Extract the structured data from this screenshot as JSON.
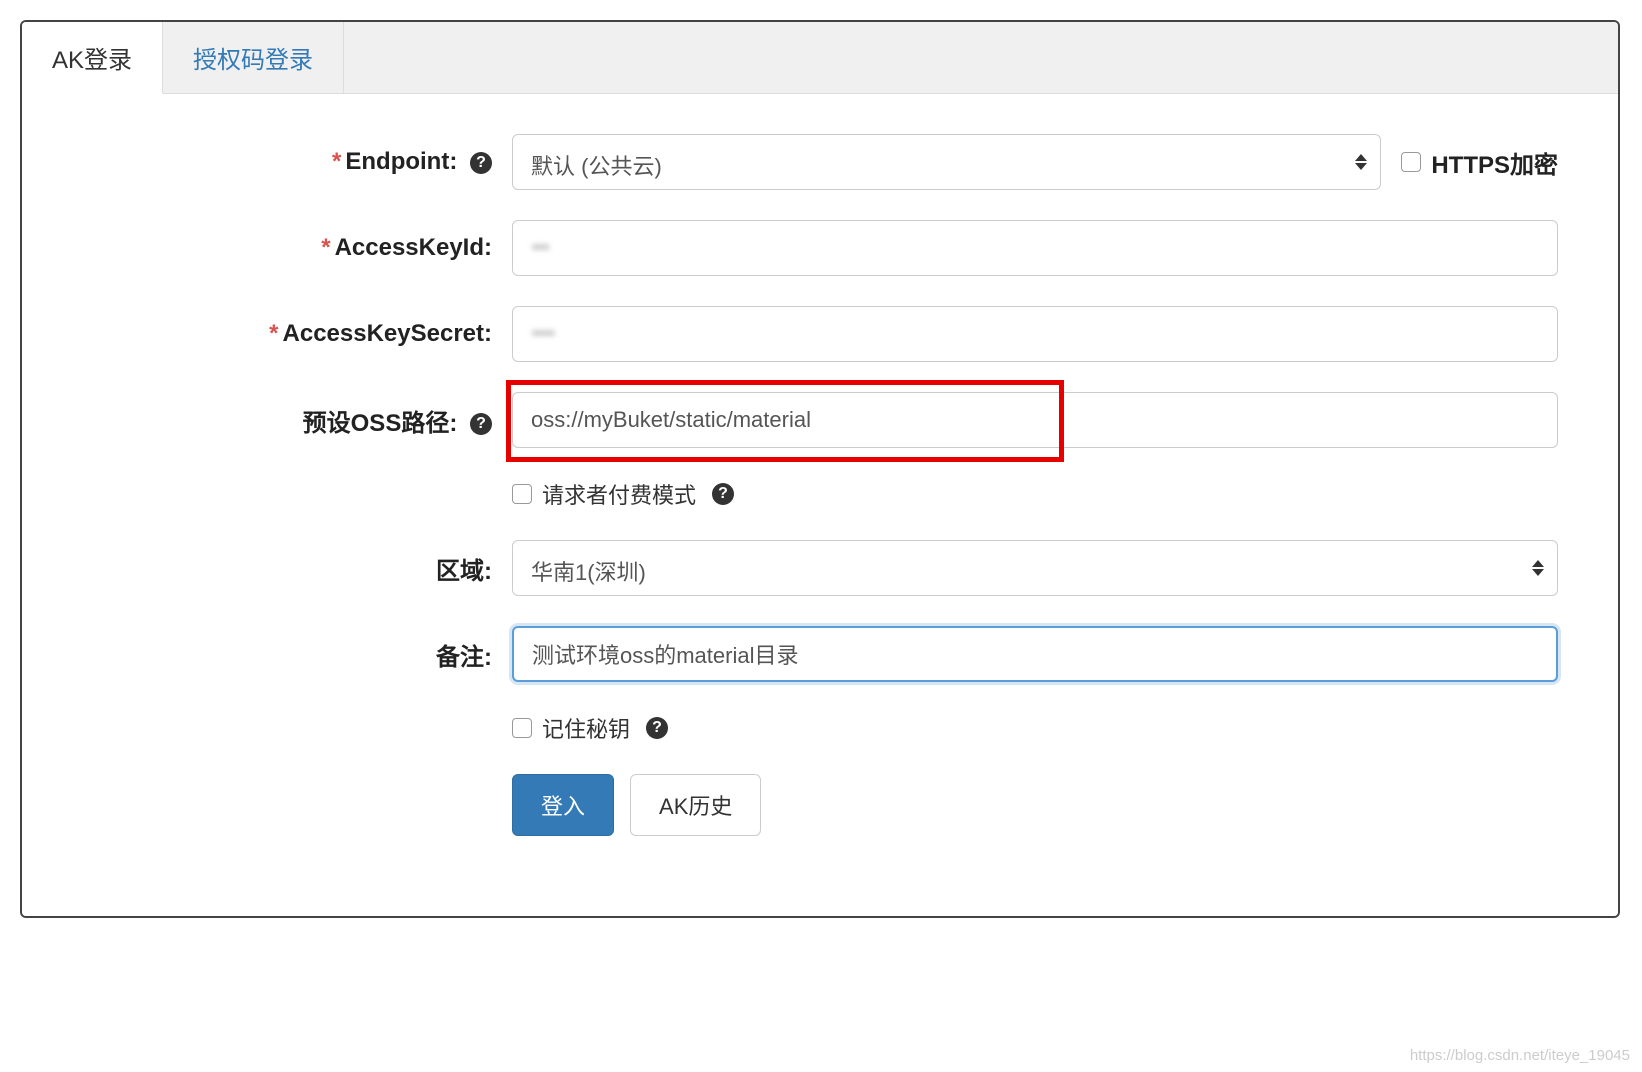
{
  "tabs": {
    "ak_login": "AK登录",
    "auth_code_login": "授权码登录"
  },
  "form": {
    "endpoint": {
      "label": "Endpoint:",
      "value": "默认 (公共云)"
    },
    "https": {
      "label": "HTTPS加密"
    },
    "access_key_id": {
      "label": "AccessKeyId:",
      "value": "▪▪▪"
    },
    "access_key_secret": {
      "label": "AccessKeySecret:",
      "value": "▪▪▪▪"
    },
    "oss_path": {
      "label": "预设OSS路径:",
      "value": "oss://myBuket/static/material"
    },
    "requester_pays": {
      "label": "请求者付费模式"
    },
    "region": {
      "label": "区域:",
      "value": "华南1(深圳)"
    },
    "remark": {
      "label": "备注:",
      "value": "测试环境oss的material目录"
    },
    "remember_key": {
      "label": "记住秘钥"
    }
  },
  "buttons": {
    "login": "登入",
    "ak_history": "AK历史"
  },
  "watermark": "https://blog.csdn.net/iteye_19045"
}
